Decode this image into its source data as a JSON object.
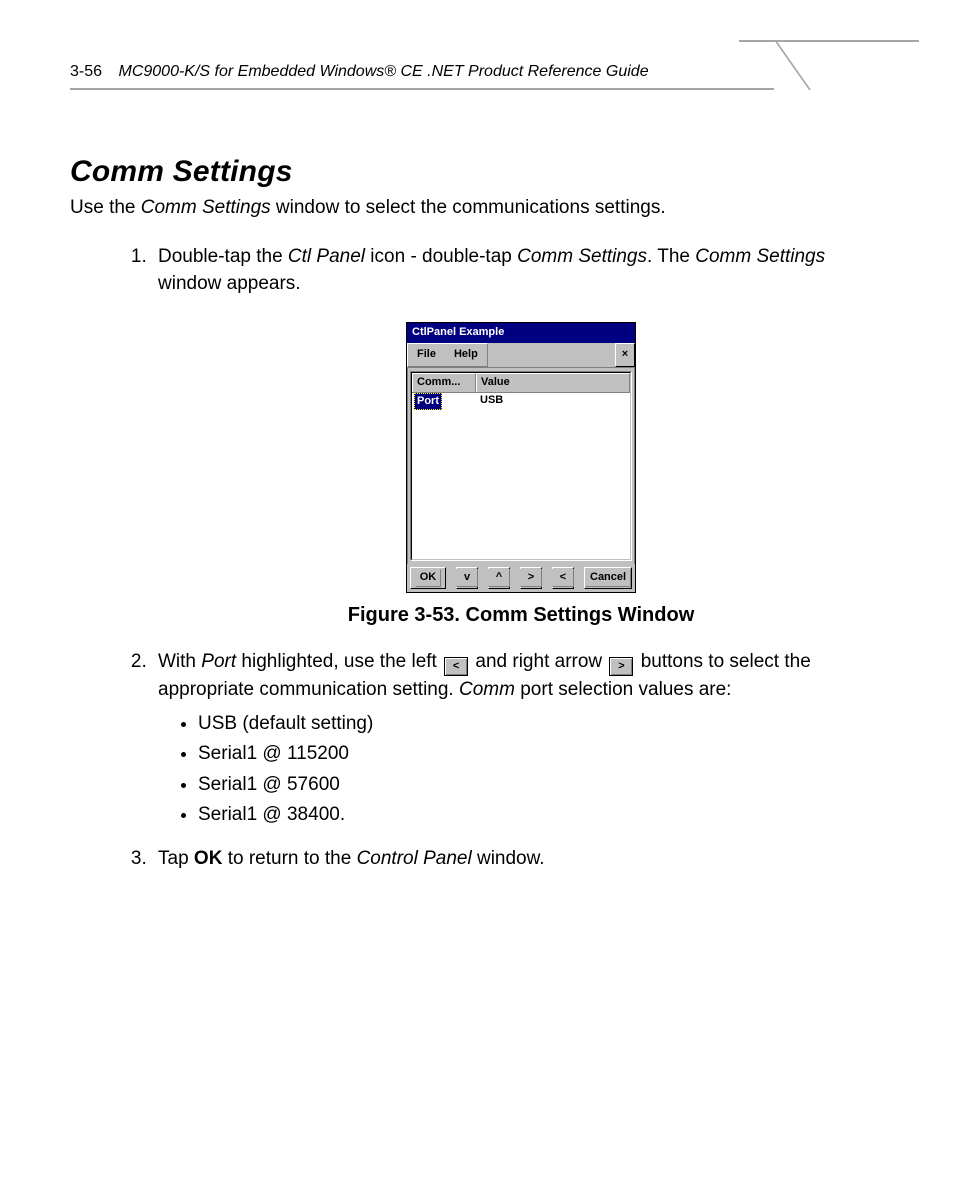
{
  "header": {
    "page_number": "3-56",
    "running_title": "MC9000-K/S for Embedded Windows® CE .NET Product Reference Guide"
  },
  "section": {
    "title": "Comm Settings",
    "intro_prefix": "Use the ",
    "intro_em": "Comm Settings",
    "intro_suffix": " window to select the communications settings."
  },
  "steps": {
    "s1": {
      "t1": "Double-tap the ",
      "em1": "Ctl Panel",
      "t2": " icon - double-tap ",
      "em2": "Comm Settings",
      "t3": ". The ",
      "em3": "Comm Settings",
      "t4": " window appears."
    },
    "s2": {
      "t1": "With ",
      "em1": "Port",
      "t2": " highlighted, use the left ",
      "t3": " and right arrow ",
      "t4": " buttons to select the appropriate communication setting. ",
      "em2": "Comm",
      "t5": " port selection values are:"
    },
    "s3": {
      "t1": "Tap ",
      "b1": "OK",
      "t2": " to return to the ",
      "em1": "Control Panel",
      "t3": " window."
    }
  },
  "bullets": {
    "b1": "USB (default setting)",
    "b2": "Serial1 @ 115200",
    "b3": "Serial1 @ 57600",
    "b4": "Serial1 @ 38400."
  },
  "figure": {
    "caption": "Figure 3-53.  Comm Settings Window"
  },
  "dialog": {
    "title": "CtlPanel Example",
    "menu": {
      "file": "File",
      "help": "Help",
      "close": "×"
    },
    "columns": {
      "c1": "Comm...",
      "c2": "Value"
    },
    "row": {
      "name": "Port",
      "value": "USB"
    },
    "buttons": {
      "ok": "OK",
      "down": "v",
      "up": "^",
      "right": ">",
      "left": "<",
      "cancel": "Cancel"
    }
  },
  "inline_arrows": {
    "left": "<",
    "right": ">"
  }
}
